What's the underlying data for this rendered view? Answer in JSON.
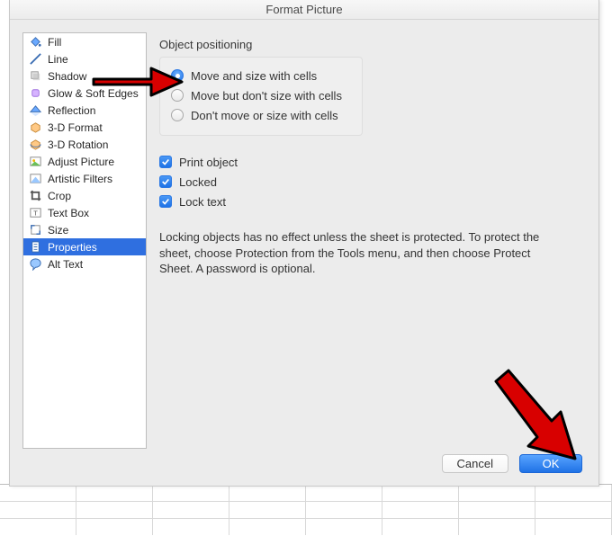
{
  "dialog": {
    "title": "Format Picture"
  },
  "sidebar": {
    "items": [
      {
        "label": "Fill",
        "icon": "fill-bucket-icon"
      },
      {
        "label": "Line",
        "icon": "line-icon"
      },
      {
        "label": "Shadow",
        "icon": "shadow-icon"
      },
      {
        "label": "Glow & Soft Edges",
        "icon": "glow-icon"
      },
      {
        "label": "Reflection",
        "icon": "reflection-icon"
      },
      {
        "label": "3-D Format",
        "icon": "format3d-icon"
      },
      {
        "label": "3-D Rotation",
        "icon": "rotation3d-icon"
      },
      {
        "label": "Adjust Picture",
        "icon": "adjust-picture-icon"
      },
      {
        "label": "Artistic Filters",
        "icon": "filters-icon"
      },
      {
        "label": "Crop",
        "icon": "crop-icon"
      },
      {
        "label": "Text Box",
        "icon": "textbox-icon"
      },
      {
        "label": "Size",
        "icon": "size-icon"
      },
      {
        "label": "Properties",
        "icon": "properties-icon",
        "selected": true
      },
      {
        "label": "Alt Text",
        "icon": "alttext-icon"
      }
    ]
  },
  "content": {
    "section_label": "Object positioning",
    "radios": [
      {
        "label": "Move and size with cells",
        "checked": true
      },
      {
        "label": "Move but don't size with cells",
        "checked": false
      },
      {
        "label": "Don't move or size with cells",
        "checked": false
      }
    ],
    "checks": [
      {
        "label": "Print object",
        "checked": true
      },
      {
        "label": "Locked",
        "checked": true
      },
      {
        "label": "Lock text",
        "checked": true
      }
    ],
    "help_text": "Locking objects has no effect unless the sheet is protected.  To protect the sheet, choose Protection from the Tools menu, and then choose Protect Sheet.  A password is optional."
  },
  "footer": {
    "cancel": "Cancel",
    "ok": "OK"
  },
  "colors": {
    "accent": "#1f72e6",
    "arrow": "#d80000"
  }
}
